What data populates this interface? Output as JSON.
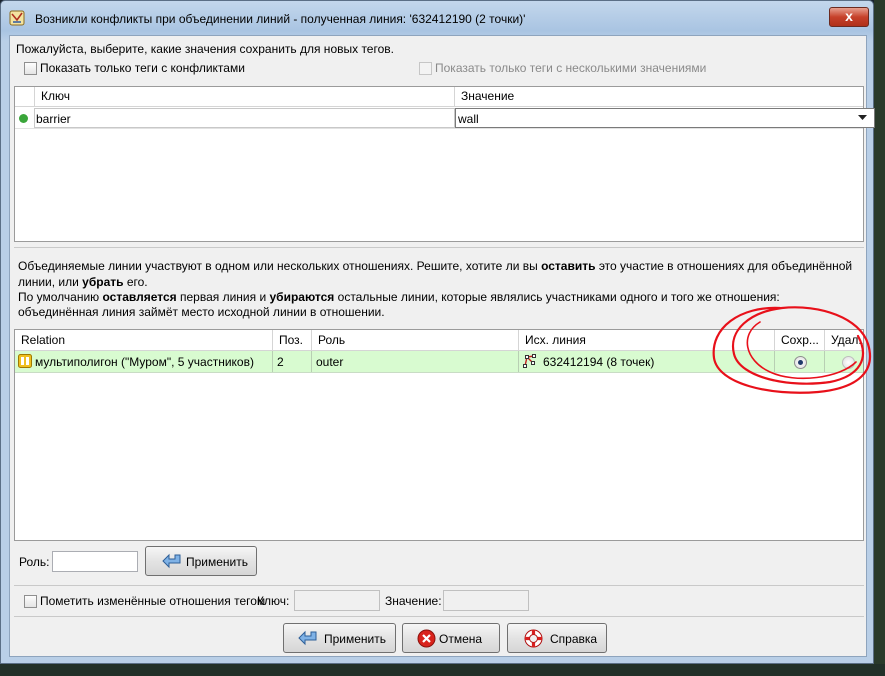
{
  "window": {
    "title": "Возникли конфликты при объединении линий - полученная линия: '632412190 (2 точки)'",
    "close_glyph": "x"
  },
  "tags": {
    "prompt": "Пожалуйста, выберите, какие значения сохранить для новых тегов.",
    "show_conflicts_label": "Показать только теги с конфликтами",
    "show_multi_label": "Показать только теги с несколькими значениями",
    "columns": {
      "key": "Ключ",
      "value": "Значение"
    },
    "rows": [
      {
        "key": "barrier",
        "value": "wall",
        "status_color": "#3aa63a"
      }
    ]
  },
  "relations": {
    "info_line1_a": "Объединяемые линии участвуют в одном или нескольких отношениях. Решите, хотите ли вы ",
    "info_line1_b": "оставить",
    "info_line1_c": " это участие в отношениях для объединённой",
    "info_line2_a": "линии, или ",
    "info_line2_b": "убрать",
    "info_line2_c": " его.",
    "info_line3_a": "По умолчанию ",
    "info_line3_b": "оставляется",
    "info_line3_c": " первая линия и ",
    "info_line3_d": "убираются",
    "info_line3_e": " остальные линии, которые являлись участниками одного и того же отношения:",
    "info_line4": "объединённая линия займёт место исходной линии в отношении.",
    "columns": {
      "relation": "Relation",
      "pos": "Поз.",
      "role": "Роль",
      "source": "Исх. линия",
      "keep": "Сохр...",
      "remove": "Удал..."
    },
    "rows": [
      {
        "relation": "мультиполигон (\"Муром\", 5 участников)",
        "pos": "2",
        "role": "outer",
        "source": "632412194 (8 точек)",
        "keep_selected": true
      }
    ]
  },
  "role_form": {
    "label": "Роль:",
    "value": "",
    "apply_label": "Применить"
  },
  "tag_form": {
    "mark_label": "Пометить изменённые отношения тегом",
    "key_label": "Ключ:",
    "value_label": "Значение:"
  },
  "buttons": {
    "apply": "Применить",
    "cancel": "Отмена",
    "help": "Справка"
  },
  "colors": {
    "row_highlight": "#d8fbd0",
    "annotation": "#e8101a"
  }
}
